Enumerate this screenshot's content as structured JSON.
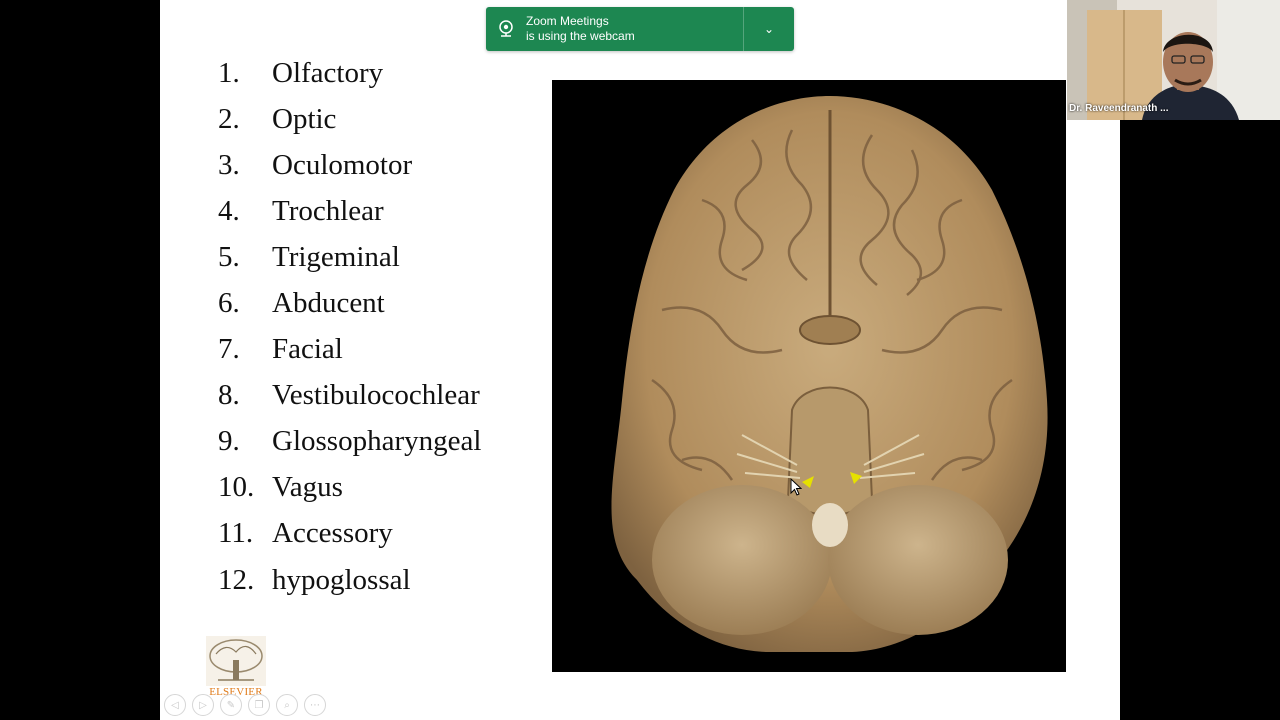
{
  "slide": {
    "nerves": [
      {
        "num": "1.",
        "name": "Olfactory"
      },
      {
        "num": "2.",
        "name": "Optic"
      },
      {
        "num": "3.",
        "name": "Oculomotor"
      },
      {
        "num": "4.",
        "name": "Trochlear"
      },
      {
        "num": "5.",
        "name": "Trigeminal"
      },
      {
        "num": "6.",
        "name": "Abducent"
      },
      {
        "num": "7.",
        "name": "Facial"
      },
      {
        "num": "8.",
        "name": "Vestibulocochlear"
      },
      {
        "num": "9.",
        "name": "Glossopharyngeal"
      },
      {
        "num": "10.",
        "name": "Vagus"
      },
      {
        "num": "11.",
        "name": "Accessory"
      },
      {
        "num": "12.",
        "name": "hypoglossal"
      }
    ],
    "publisher": "ELSEVIER",
    "toolbar_icons": [
      "prev-icon",
      "play-icon",
      "pen-icon",
      "copy-icon",
      "zoom-icon",
      "more-icon"
    ]
  },
  "notification": {
    "title": "Zoom Meetings",
    "subtitle": "is using the webcam",
    "color": "#1d8751"
  },
  "video": {
    "participant_name": "Dr. Raveendranath ..."
  }
}
